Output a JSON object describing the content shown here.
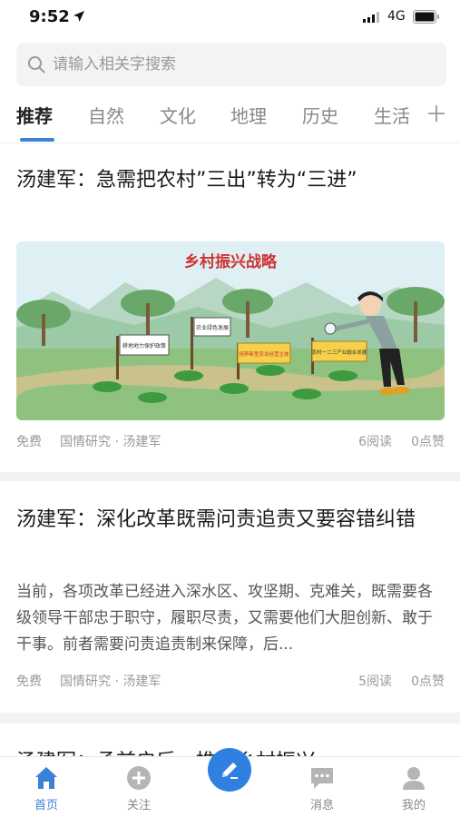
{
  "status": {
    "time": "9:52",
    "network": "4G"
  },
  "search": {
    "placeholder": "请输入相关字搜索"
  },
  "tabs": [
    {
      "label": "推荐",
      "active": true
    },
    {
      "label": "自然"
    },
    {
      "label": "文化"
    },
    {
      "label": "地理"
    },
    {
      "label": "历史"
    },
    {
      "label": "生活"
    }
  ],
  "articles": [
    {
      "title": "汤建军：急需把农村”三出”转为“三进”",
      "image": {
        "banner": "乡村振兴战略",
        "signs": [
          "耕地地力保护政策",
          "农业绿色发展",
          "培养新型农业经营主体",
          "农村一二三产业融合发展"
        ]
      },
      "free": "免费",
      "source": "国情研究 · 汤建军",
      "reads": "6阅读",
      "likes": "0点赞"
    },
    {
      "title": "汤建军：深化改革既需问责追责又要容错纠错",
      "summary": "当前，各项改革已经进入深水区、攻坚期、克难关，既需要各级领导干部忠于职守，履职尽责，又需要他们大胆创新、敢于干事。前者需要问责追责制来保障，后...",
      "free": "免费",
      "source": "国情研究 · 汤建军",
      "reads": "5阅读",
      "likes": "0点赞"
    },
    {
      "title": "汤建军：承前启后，推进乡村振兴"
    }
  ],
  "bottom_nav": [
    {
      "label": "首页",
      "icon": "home-icon",
      "active": true
    },
    {
      "label": "关注",
      "icon": "plus-circle-icon"
    },
    {
      "label": "",
      "icon": "pencil-icon"
    },
    {
      "label": "消息",
      "icon": "message-icon"
    },
    {
      "label": "我的",
      "icon": "user-icon"
    }
  ],
  "colors": {
    "accent": "#2f80e0",
    "tab_underline": "#3a82d8"
  }
}
